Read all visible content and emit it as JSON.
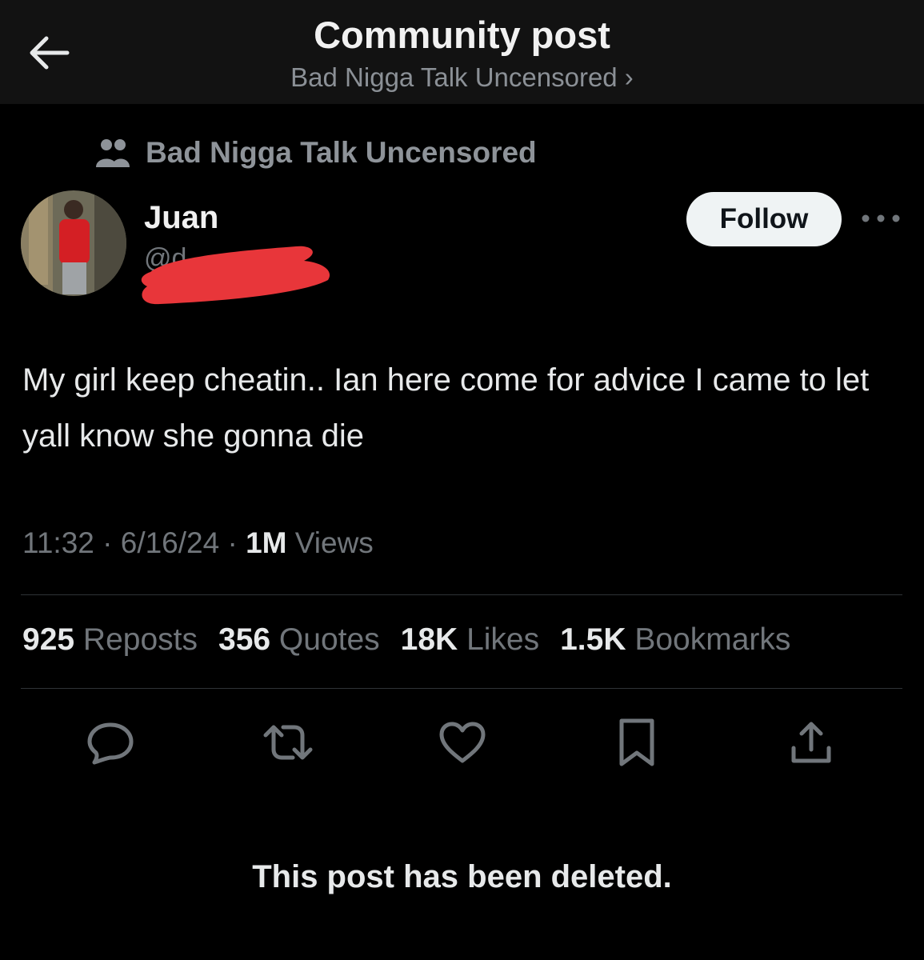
{
  "header": {
    "title": "Community post",
    "subtitle": "Bad Nigga Talk Uncensored ›",
    "back_icon": "arrow-left-icon"
  },
  "community": {
    "icon": "people-icon",
    "name": "Bad Nigga Talk Uncensored"
  },
  "author": {
    "name": "Juan",
    "handle": "@d",
    "follow_label": "Follow",
    "more_icon": "more-dots-icon",
    "redaction_color": "#e8363a"
  },
  "post": {
    "text": "My girl keep cheatin.. Ian here come for advice I came to let yall know she gonna die",
    "time": "11:32",
    "date": "6/16/24",
    "views_count": "1M",
    "views_label": "Views"
  },
  "stats": [
    {
      "count": "925",
      "label": "Reposts"
    },
    {
      "count": "356",
      "label": "Quotes"
    },
    {
      "count": "18K",
      "label": "Likes"
    },
    {
      "count": "1.5K",
      "label": "Bookmarks"
    }
  ],
  "actions": [
    "reply-icon",
    "repost-icon",
    "like-icon",
    "bookmark-icon",
    "share-icon"
  ],
  "footer": {
    "deleted_notice": "This post has been deleted."
  },
  "colors": {
    "background": "#000000",
    "header_bg": "#121212",
    "secondary_text": "#71767b",
    "follow_bg": "#eff3f4"
  }
}
